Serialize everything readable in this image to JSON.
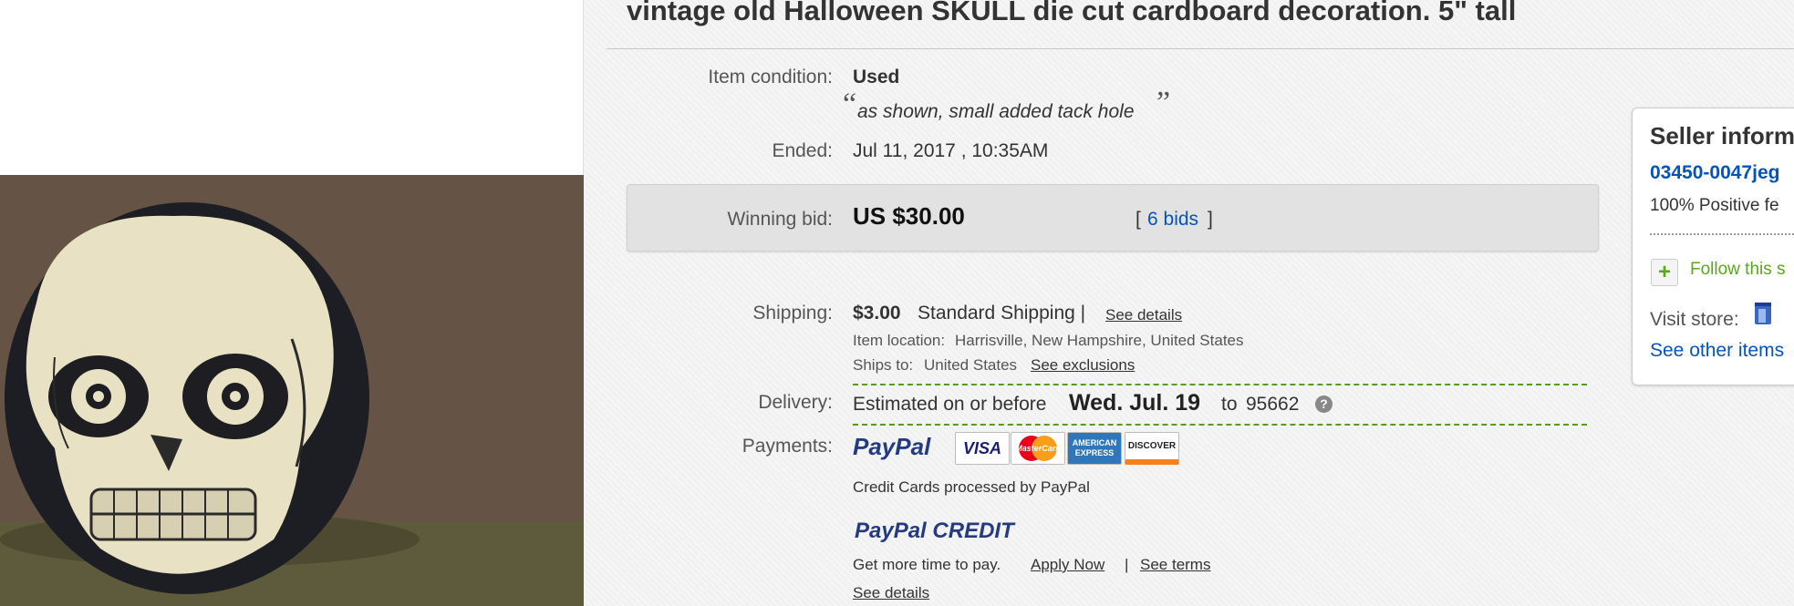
{
  "listing": {
    "title": "vintage old Halloween SKULL die cut cardboard decoration. 5\" tall"
  },
  "condition": {
    "label": "Item condition:",
    "value": "Used",
    "open_quote": "“",
    "note": "as shown, small added tack hole",
    "close_quote": "”"
  },
  "ended": {
    "label": "Ended:",
    "value": "Jul 11, 2017 , 10:35AM"
  },
  "bid": {
    "label": "Winning bid:",
    "value": "US $30.00",
    "open_bracket": "[",
    "bids_link": "6 bids",
    "close_bracket": "]"
  },
  "shipping": {
    "label": "Shipping:",
    "cost": "$3.00",
    "service": "Standard Shipping |",
    "details_link": "See details",
    "location_label": "Item location:",
    "location": "Harrisville, New Hampshire, United States",
    "ships_to_label": "Ships to:",
    "ships_to": "United States",
    "exclusions_link": "See exclusions"
  },
  "delivery": {
    "label": "Delivery:",
    "prefix": "Estimated on or before",
    "date": "Wed. Jul. 19",
    "to": "to",
    "zip": "95662",
    "help_icon": "?"
  },
  "payments": {
    "label": "Payments:",
    "paypal_logo": "PayPal",
    "cards": [
      "VISA",
      "MasterCard",
      "AMERICAN EXPRESS",
      "DISCOVER"
    ],
    "processed_note": "Credit Cards processed by PayPal",
    "credit_logo_a": "PayPal",
    "credit_logo_b": "CREDIT",
    "credit_text": "Get more time to pay.",
    "apply_link": "Apply Now",
    "separator": "|",
    "terms_link": "See terms",
    "details_link": "See details"
  },
  "seller": {
    "heading": "Seller inform",
    "username": "03450-0047jeg",
    "feedback": "100% Positive fe",
    "follow_label": "Follow this s",
    "visit_store": "Visit store:",
    "other_items": "See other items"
  },
  "colors": {
    "link": "#0654ba",
    "green_dash": "#5a9a1a",
    "follow_green": "#5ba71b",
    "paypal_dark": "#253b80",
    "paypal_light": "#179bd7"
  }
}
